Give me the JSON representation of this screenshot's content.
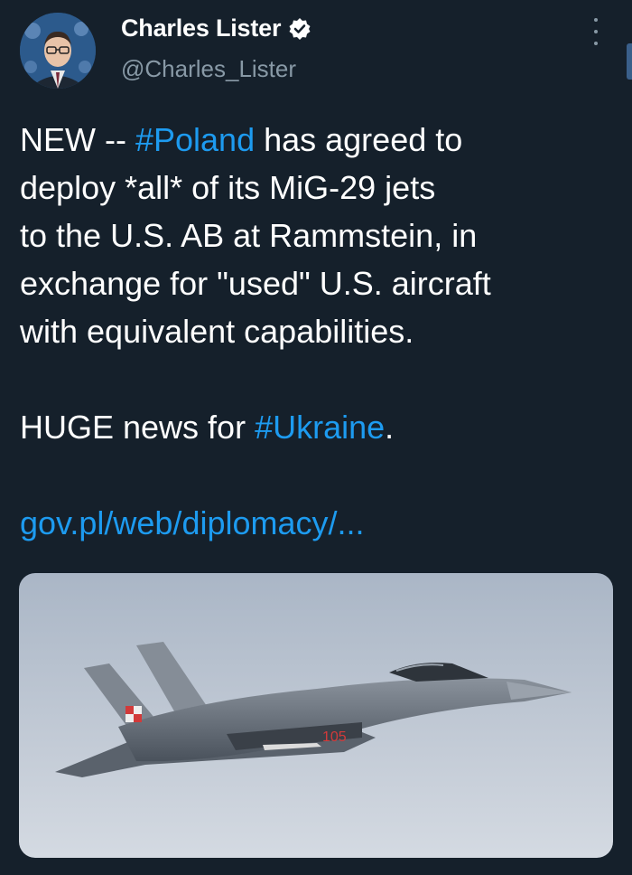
{
  "author": {
    "name": "Charles Lister",
    "handle": "@Charles_Lister",
    "verified_icon": "verified-badge-icon"
  },
  "tweet": {
    "line1_a": "NEW -- ",
    "hashtag_poland": "#Poland",
    "line1_b": " has agreed to",
    "line2": "deploy *all* of its MiG-29 jets",
    "line3": "to the U.S. AB at Rammstein, in",
    "line4": "exchange for \"used\" U.S. aircraft",
    "line5": "with equivalent capabilities.",
    "line6_a": "HUGE news for ",
    "hashtag_ukraine": "#Ukraine",
    "line6_b": ".",
    "link": "gov.pl/web/diplomacy/..."
  },
  "media": {
    "tail_number": "105",
    "description_icon": "mig-29-jet-photo"
  },
  "colors": {
    "background": "#15202b",
    "link": "#1d9bf0",
    "secondary_text": "#8899a6"
  }
}
